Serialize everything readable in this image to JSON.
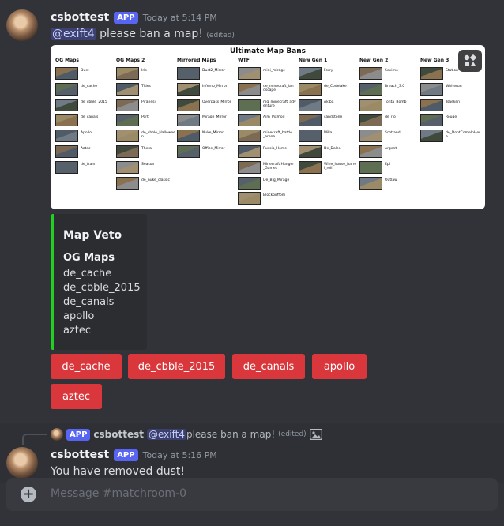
{
  "message1": {
    "author": "csbottest",
    "tag": "APP",
    "timestamp": "Today at 5:14 PM",
    "mention": "@exift4",
    "text": " please ban a map!",
    "edited": "(edited)"
  },
  "ban_image": {
    "title": "Ultimate Map Bans",
    "columns": [
      {
        "name": "OG Maps",
        "maps": [
          "Dust",
          "de_cache",
          "de_cbble_2015",
          "de_canals",
          "Apollo",
          "Aztec",
          "de_train"
        ]
      },
      {
        "name": "OG Maps 2",
        "maps": [
          "Iris",
          "Tides",
          "Piranesi",
          "Port",
          "de_cbble_Hallowee n",
          "Thera",
          "Season",
          "de_nuke_classic"
        ]
      },
      {
        "name": "Mirrored Maps",
        "maps": [
          "Dust2_Mirror",
          "Inferno_Mirror",
          "Overpass_Mirror",
          "Mirage_Mirror",
          "Nuke_Mirror",
          "Office_Mirror"
        ]
      },
      {
        "name": "WTF",
        "maps": [
          "mini_mirage",
          "de_minecraft_ian dscape",
          "mg_minecraft_adv enture",
          "Aim_Pixmod",
          "minecraft_battle _arena",
          "Russia_Home",
          "Minecraft Hunger _Games",
          "De_Big_Mirage",
          "Blockbuffom"
        ]
      },
      {
        "name": "New Gen 1",
        "maps": [
          "Ferry",
          "de_Codelake",
          "Akiba",
          "sandstone",
          "Milla",
          "De_Dalen",
          "Wine_house_barre l_roll"
        ]
      },
      {
        "name": "New Gen 2",
        "maps": [
          "Sevirno",
          "Breach_3.0",
          "Tonta_Bomb",
          "de_rio",
          "Scotland",
          "Argent",
          "Epi",
          "Outlaw"
        ]
      },
      {
        "name": "New Gen 3",
        "maps": [
          "Station",
          "Whiterun",
          "Tsaeken",
          "Rouge",
          "de_DontComeInHer e"
        ]
      }
    ],
    "game_button_icon": "game-controller-icon"
  },
  "embed": {
    "title": "Map Veto",
    "field_name": "OG Maps",
    "values": [
      "de_cache",
      "de_cbble_2015",
      "de_canals",
      "apollo",
      "aztec"
    ],
    "accent_color": "#22d022"
  },
  "buttons": [
    "de_cache",
    "de_cbble_2015",
    "de_canals",
    "apollo",
    "aztec"
  ],
  "reply": {
    "tag": "APP",
    "author": "csbottest",
    "mention": "@exift4",
    "text": " please ban a map!",
    "edited": "(edited)",
    "image_icon": "image-icon"
  },
  "message2": {
    "author": "csbottest",
    "tag": "APP",
    "timestamp": "Today at 5:16 PM",
    "text": "You have removed dust!"
  },
  "composer": {
    "placeholder": "Message #matchroom-0"
  }
}
